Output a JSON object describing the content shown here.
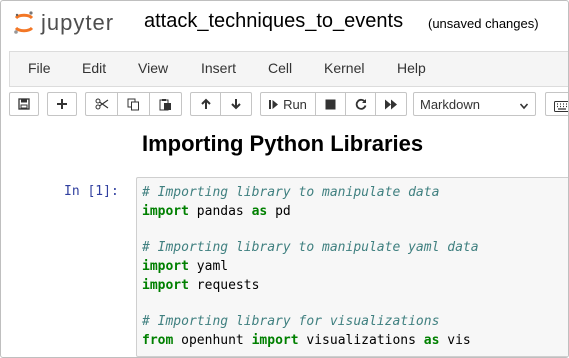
{
  "header": {
    "logo_text": "jupyter",
    "notebook_name": "attack_techniques_to_events",
    "save_status": "(unsaved changes)"
  },
  "menu": [
    "File",
    "Edit",
    "View",
    "Insert",
    "Cell",
    "Kernel",
    "Help"
  ],
  "toolbar": {
    "icons": [
      "save-icon",
      "plus-icon",
      "cut-icon",
      "copy-icon",
      "paste-icon",
      "arrow-up-icon",
      "arrow-down-icon",
      "run-icon",
      "stop-icon",
      "restart-icon",
      "fast-forward-icon",
      "keyboard-icon"
    ],
    "run_label": "Run",
    "cell_type": "Markdown"
  },
  "notebook": {
    "heading": "Importing Python Libraries",
    "cell": {
      "prompt": "In [1]:",
      "lines": [
        {
          "comment": "# Importing library to manipulate data"
        },
        {
          "kw": "import",
          "rest": " pandas ",
          "kw2": "as",
          "rest2": " pd"
        },
        {
          "blank": ""
        },
        {
          "comment": "# Importing library to manipulate yaml data"
        },
        {
          "kw": "import",
          "rest": " yaml"
        },
        {
          "kw": "import",
          "rest": " requests"
        },
        {
          "blank": ""
        },
        {
          "comment": "# Importing library for visualizations"
        },
        {
          "kw": "from",
          "rest": " openhunt ",
          "kw2": "import",
          "rest2": " visualizations ",
          "kw3": "as",
          "rest3": " vis"
        }
      ]
    }
  },
  "colors": {
    "comment": "#408080",
    "keyword": "#008000",
    "prompt": "#303f9f",
    "logo_orange": "#f37726"
  }
}
